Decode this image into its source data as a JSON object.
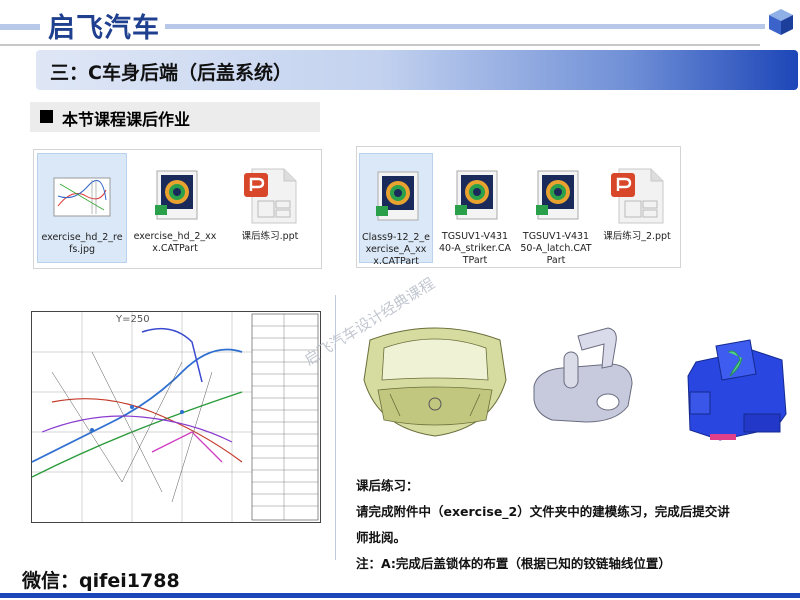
{
  "brand": {
    "title": "启飞汽车"
  },
  "section": {
    "title": "三：C车身后端（后盖系统）"
  },
  "homework": {
    "heading": "本节课程课后作业"
  },
  "left_files": [
    {
      "name": "exercise_hd_2_refs.jpg",
      "icon": "jpg-icon"
    },
    {
      "name": "exercise_hd_2_xxx.CATPart",
      "icon": "catpart-icon"
    },
    {
      "name": "课后练习.ppt",
      "icon": "ppt-icon"
    }
  ],
  "right_files": [
    {
      "name": "Class9-12_2_exercise_A_xxx.CATPart",
      "icon": "catpart-icon"
    },
    {
      "name": "TGSUV1-V43140-A_striker.CATPart",
      "icon": "catpart-icon"
    },
    {
      "name": "TGSUV1-V43150-A_latch.CATPart",
      "icon": "catpart-icon"
    },
    {
      "name": "课后练习_2.ppt",
      "icon": "ppt-icon"
    }
  ],
  "drawing": {
    "top_label": "Y=250"
  },
  "notes": {
    "heading": "课后练习：",
    "line1": "请完成附件中（exercise_2）文件夹中的建模练习，完成后提交讲",
    "line2": "师批阅。",
    "line3": "注：A:完成后盖锁体的布置（根据已知的铰链轴线位置）"
  },
  "watermark": "启飞汽车设计经典课程",
  "contact": {
    "wechat": "微信：qifei1788"
  },
  "colors": {
    "brand": "#1f3f8f",
    "accent": "#1d46b8"
  }
}
